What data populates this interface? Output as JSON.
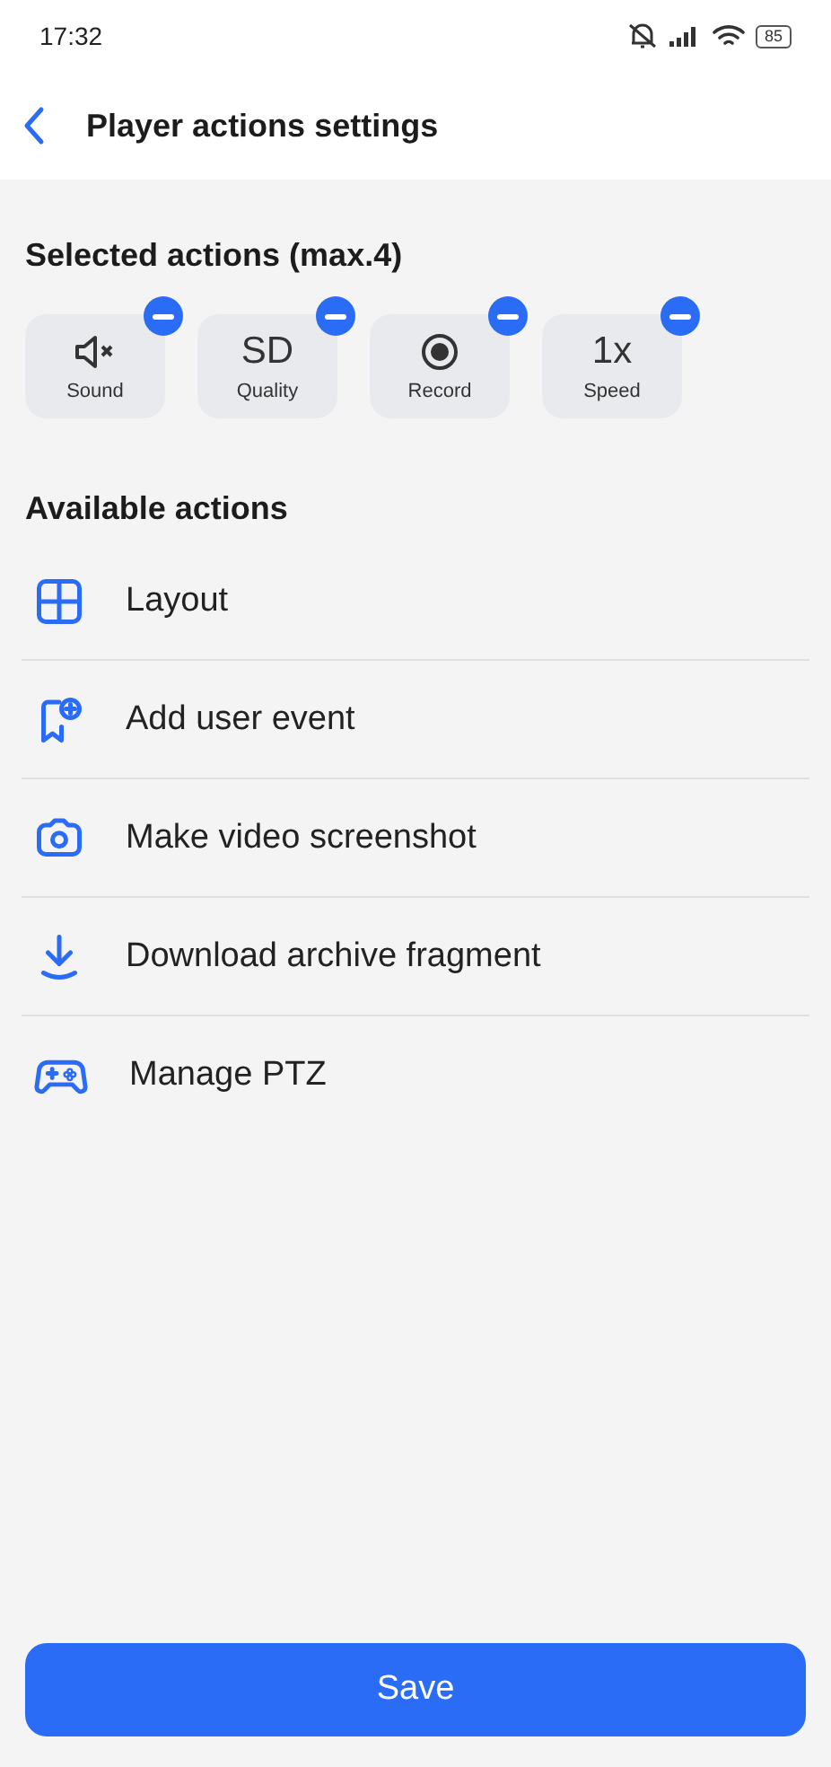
{
  "status_bar": {
    "time": "17:32",
    "battery": "85"
  },
  "header": {
    "title": "Player actions settings"
  },
  "selected_section": {
    "title": "Selected actions (max.4)",
    "actions": [
      {
        "kind": "mute",
        "label": "Sound"
      },
      {
        "kind": "text",
        "glyph": "SD",
        "label": "Quality"
      },
      {
        "kind": "record",
        "label": "Record"
      },
      {
        "kind": "text",
        "glyph": "1x",
        "label": "Speed"
      }
    ]
  },
  "available_section": {
    "title": "Available actions",
    "actions": [
      {
        "kind": "grid",
        "label": "Layout"
      },
      {
        "kind": "event",
        "label": "Add user event"
      },
      {
        "kind": "camera",
        "label": "Make video screenshot"
      },
      {
        "kind": "download",
        "label": "Download archive fragment"
      },
      {
        "kind": "gamepad",
        "label": "Manage PTZ"
      }
    ]
  },
  "save_button": "Save"
}
